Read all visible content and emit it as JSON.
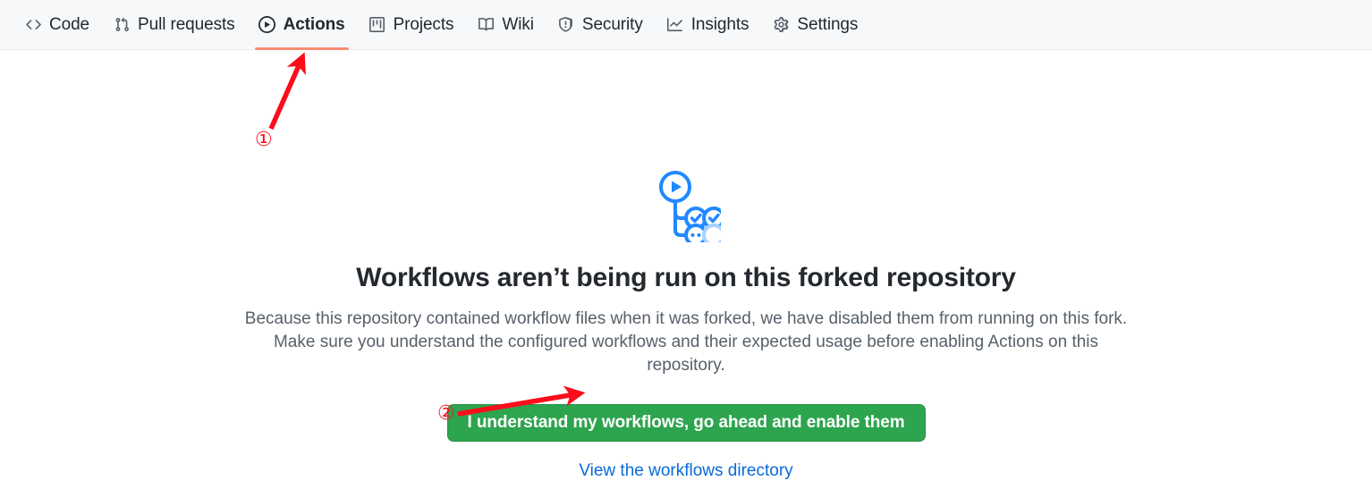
{
  "nav": {
    "items": [
      {
        "label": "Code",
        "icon": "code-icon",
        "selected": false
      },
      {
        "label": "Pull requests",
        "icon": "git-pull-request-icon",
        "selected": false
      },
      {
        "label": "Actions",
        "icon": "play-circle-icon",
        "selected": true
      },
      {
        "label": "Projects",
        "icon": "project-board-icon",
        "selected": false
      },
      {
        "label": "Wiki",
        "icon": "book-icon",
        "selected": false
      },
      {
        "label": "Security",
        "icon": "shield-alert-icon",
        "selected": false
      },
      {
        "label": "Insights",
        "icon": "graph-line-icon",
        "selected": false
      },
      {
        "label": "Settings",
        "icon": "gear-icon",
        "selected": false
      }
    ],
    "selected_underline_color": "#fd8c73",
    "background_color": "#f6f8fa"
  },
  "main": {
    "logo_icon": "github-actions-workflow-icon",
    "heading": "Workflows aren’t being run on this forked repository",
    "description_line_1": "Because this repository contained workflow files when it was forked, we have disabled them from running on this fork. Make sure",
    "description_line_2": "you understand the configured workflows and their expected usage before enabling Actions on this repository.",
    "enable_button_label": "I understand my workflows, go ahead and enable them",
    "enable_button_color": "#2da44e",
    "workflows_link_label": "View the workflows directory",
    "link_color": "#0969da"
  },
  "annotations": {
    "color": "#fc0d1b",
    "markers": [
      {
        "label": "①",
        "target": "actions-tab"
      },
      {
        "label": "②",
        "target": "enable-workflows-button"
      }
    ]
  }
}
